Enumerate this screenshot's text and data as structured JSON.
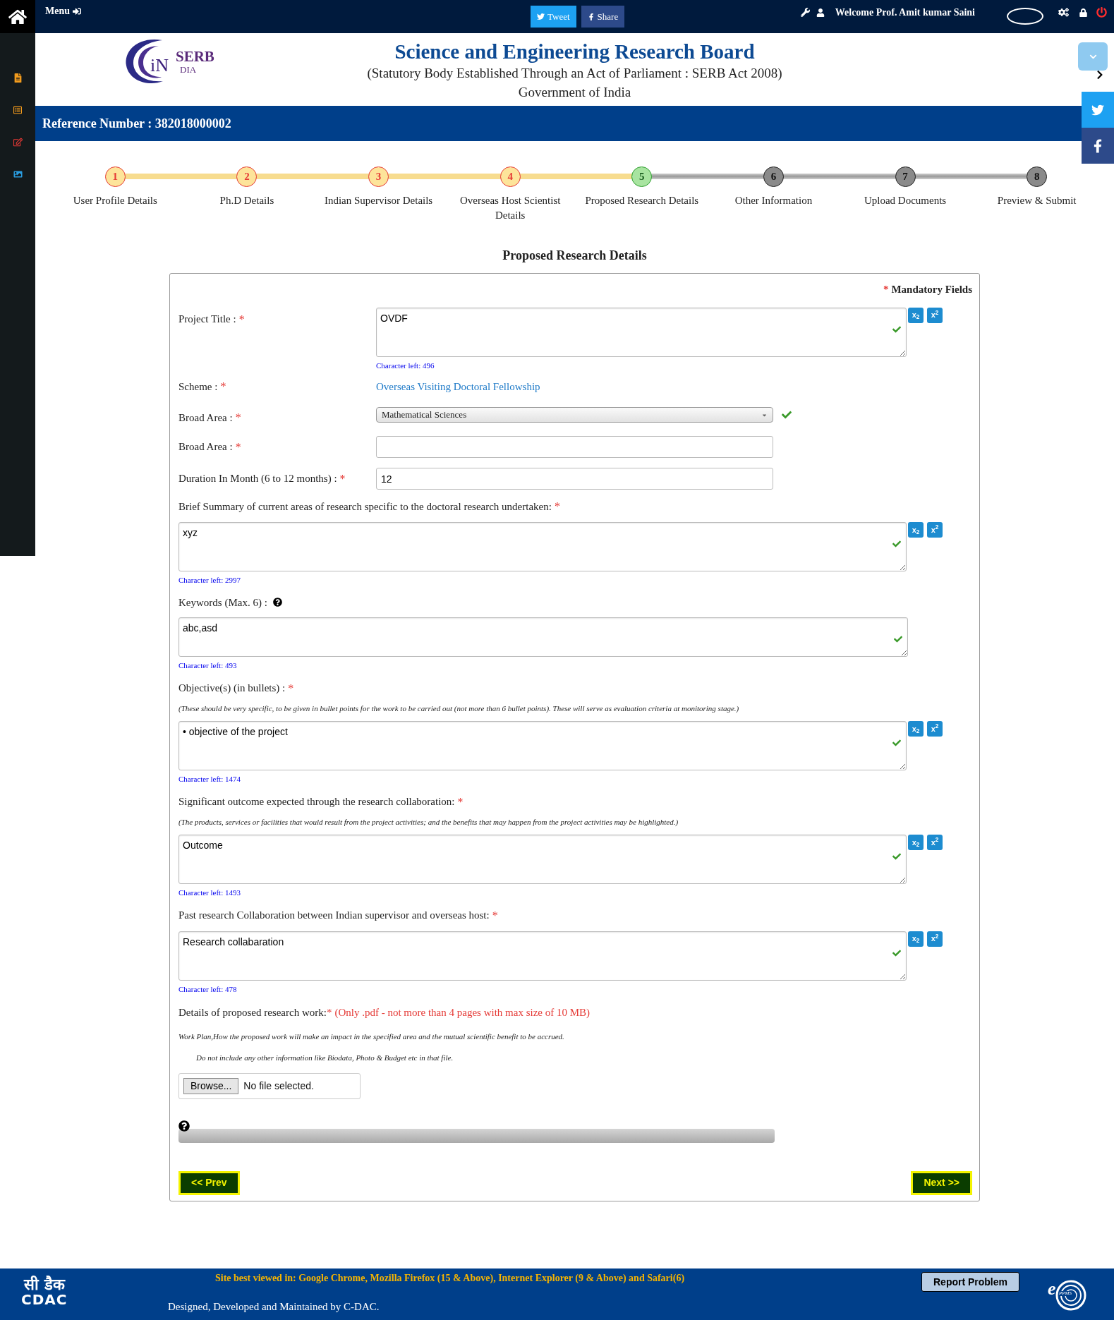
{
  "top_bar": {
    "menu": "Menu",
    "tweet": "Tweet",
    "share": "Share",
    "welcome": "Welcome Prof. Amit kumar Saini"
  },
  "header": {
    "logo": {
      "prefix": "iN",
      "name": "SERB",
      "suffix": "DIA"
    },
    "title": "Science and Engineering Research Board",
    "subtitle": "(Statutory Body Established Through an Act of Parliament : SERB Act 2008)",
    "government": "Government of India"
  },
  "reference": "Reference Number : 382018000002",
  "steps": [
    {
      "number": "1",
      "label": "User Profile Details",
      "completed": true,
      "selected": false
    },
    {
      "number": "2",
      "label": "Ph.D Details",
      "completed": true,
      "selected": false
    },
    {
      "number": "3",
      "label": "Indian Supervisor Details",
      "completed": true,
      "selected": false
    },
    {
      "number": "4",
      "label": "Overseas Host Scientist Details",
      "completed": true,
      "selected": false
    },
    {
      "number": "5",
      "label": "Proposed Research Details",
      "completed": false,
      "selected": true
    },
    {
      "number": "6",
      "label": "Other Information",
      "completed": false,
      "selected": false
    },
    {
      "number": "7",
      "label": "Upload Documents",
      "completed": false,
      "selected": false
    },
    {
      "number": "8",
      "label": "Preview & Submit",
      "completed": false,
      "selected": false
    }
  ],
  "section_title": "Proposed Research Details",
  "mandatory": {
    "mark": "*",
    "text": "Mandatory Fields"
  },
  "fields": [
    {
      "kind": "inline_textarea",
      "label": "Project Title :",
      "mark": "*",
      "value": "OVDF",
      "valid": true,
      "counter": "Character left: 496",
      "format_buttons": [
        "x$_{2}$",
        "x$^{2}$"
      ]
    },
    {
      "kind": "link",
      "label": "Scheme :",
      "mark": "*",
      "value": "Overseas Visiting Doctoral Fellowship"
    },
    {
      "kind": "select",
      "label": "Broad Area :",
      "mark": "*",
      "value": "Mathematical Sciences",
      "valid": true
    },
    {
      "kind": "input",
      "label": "Broad Area :",
      "mark": "*"
    },
    {
      "kind": "input",
      "label": "Duration In Month (6 to 12 months) :",
      "mark": "*",
      "value": "12"
    },
    {
      "kind": "textarea",
      "label": "Brief Summary of current areas of research specific to the doctoral research undertaken:",
      "mark": "*",
      "value": "xyz",
      "valid": true,
      "counter": "Character left: 2997",
      "format_buttons": [
        "x$_{2}$",
        "x$^{2}$"
      ]
    },
    {
      "kind": "textarea",
      "label": "Keywords (Max. 6) :",
      "help": true,
      "value": "abc,asd",
      "valid": true,
      "counter": "Character left: 493",
      "short": true
    },
    {
      "kind": "textarea",
      "label": "Objective(s) (in bullets) :",
      "mark": "*",
      "note": "(These should be very specific, to be given in bullet points for the work to be carried out (not more than 6 bullet points). These will serve as evaluation criteria at monitoring stage.)",
      "value": "• objective of the project",
      "valid": true,
      "counter": "Character left: 1474",
      "format_buttons": [
        "x$_{2}$",
        "x$^{2}$"
      ]
    },
    {
      "kind": "textarea",
      "label": "Significant outcome expected through the research collaboration:",
      "mark": "*",
      "note": "(The products, services or facilities that would result from the project activities; and the benefits that may happen from the project activities may be highlighted.)",
      "value": "Outcome",
      "valid": true,
      "counter": "Character left: 1493",
      "format_buttons": [
        "x$_{2}$",
        "x$^{2}$"
      ]
    },
    {
      "kind": "textarea",
      "label": "Past research Collaboration between Indian supervisor and overseas host:",
      "mark": "*",
      "value": "Research collabaration",
      "valid": true,
      "counter": "Character left: 478",
      "format_buttons": [
        "x$_{2}$",
        "x$^{2}$"
      ]
    }
  ],
  "upload": {
    "label": "Details of proposed research work:",
    "mark": "*",
    "restriction": "(Only .pdf - not more than 4 pages with max size of 10 MB)",
    "notes": [
      "Work Plan,How the proposed work will make an impact in the specified area and the mutual scientific benefit to be accrued.",
      "Do not include any other information like Biodata, Photo & Budget etc in that file."
    ],
    "browse": "Browse...",
    "file_status": "No file selected.",
    "progress": {
      "level": 0
    }
  },
  "buttons": {
    "prev": "<< Prev",
    "next": "Next >>"
  },
  "footer": {
    "cdac_logo": {
      "hindi": "सी डैक",
      "latin": "CDAC"
    },
    "browsers": "Site best viewed in: Google Chrome, Mozilla Firefox (15 & Above), Internet Explorer (9 & Above) and Safari(6)",
    "credit": "Designed, Developed and Maintained by C-DAC.",
    "report": "Report Problem",
    "eppms": {
      "e": "e",
      "name": "PPMS"
    }
  }
}
